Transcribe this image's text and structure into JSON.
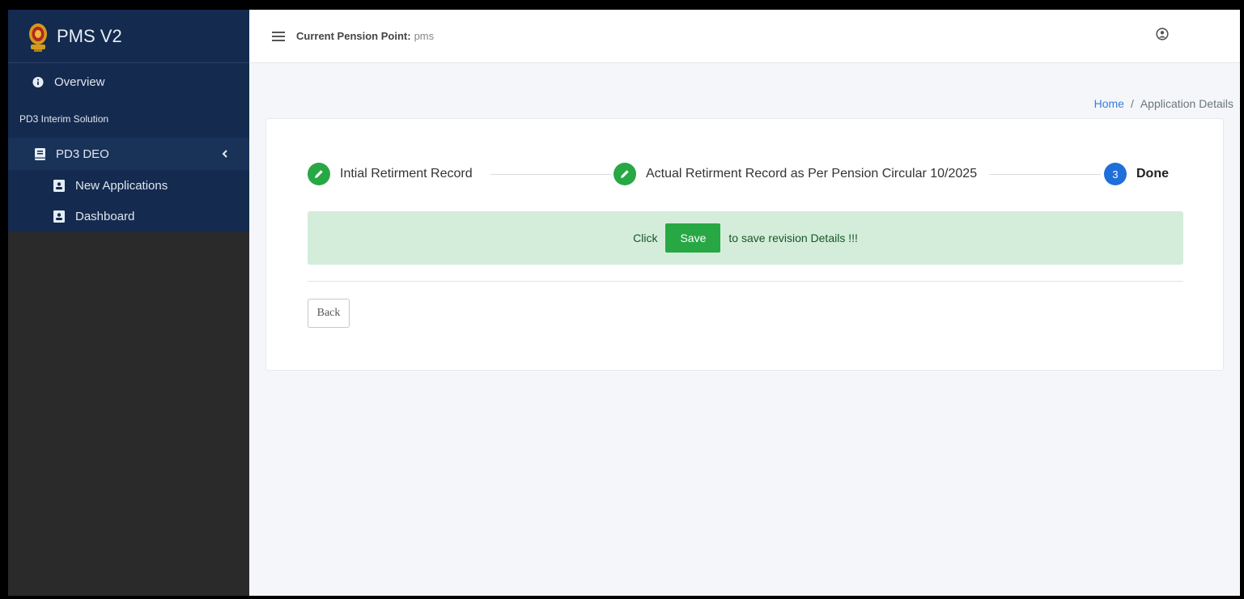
{
  "app": {
    "title": "PMS V2"
  },
  "sidebar": {
    "overview": "Overview",
    "section_header": "PD3 Interim Solution",
    "group": {
      "label": "PD3 DEO"
    },
    "items": [
      {
        "label": "New Applications"
      },
      {
        "label": "Dashboard"
      }
    ]
  },
  "topbar": {
    "pension_label": "Current Pension Point:",
    "pension_value": "pms"
  },
  "breadcrumb": {
    "home": "Home",
    "separator": "/",
    "current": "Application Details"
  },
  "stepper": {
    "steps": [
      {
        "label": "Intial Retirment Record",
        "status": "done"
      },
      {
        "label": "Actual Retirment Record as Per Pension Circular 10/2025",
        "status": "done"
      },
      {
        "number": "3",
        "label": "Done",
        "status": "current"
      }
    ]
  },
  "alert": {
    "prefix": "Click",
    "button": "Save",
    "suffix": "to save revision Details !!!"
  },
  "actions": {
    "back": "Back"
  },
  "colors": {
    "sidebar_top": "#142a4e",
    "sidebar_bottom": "#2a2a2a",
    "success": "#28a745",
    "primary": "#1e6fd9",
    "alert_bg": "#d4edda",
    "link": "#3b7ddd"
  },
  "icons": {
    "brand": "emblem-icon",
    "overview": "info-circle-icon",
    "group": "book-icon",
    "items": "address-card-icon",
    "menu": "hamburger-icon",
    "user": "user-circle-icon",
    "step_done": "pencil-icon"
  }
}
